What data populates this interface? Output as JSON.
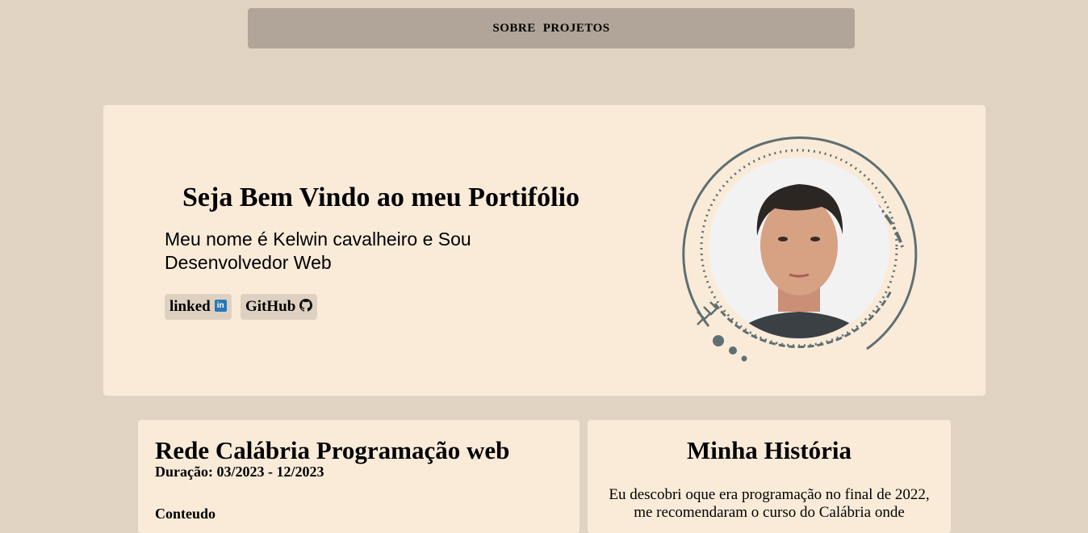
{
  "nav": {
    "items": [
      {
        "label": "SOBRE"
      },
      {
        "label": "PROJETOS"
      }
    ]
  },
  "hero": {
    "title": "Seja Bem Vindo ao meu Portifólio",
    "subtitle": "Meu nome é Kelwin cavalheiro e Sou Desenvolvedor Web",
    "links": [
      {
        "label": "linked",
        "icon": "linkedin-icon"
      },
      {
        "label": "GitHub",
        "icon": "github-icon"
      }
    ]
  },
  "course": {
    "title": "Rede Calábria Programação web",
    "duration": "Duração: 03/2023 - 12/2023",
    "content_label": "Conteudo"
  },
  "history": {
    "title": "Minha História",
    "text": "Eu descobri oque era programação no final de 2022, me recomendaram o curso do Calábria onde"
  },
  "colors": {
    "page_bg": "#e0d3c2",
    "nav_bg": "#b0a598",
    "card_bg": "#faebd9",
    "button_bg": "#ded1c1",
    "ring": "#5f6f72",
    "linkedin": "#2a78b7"
  }
}
